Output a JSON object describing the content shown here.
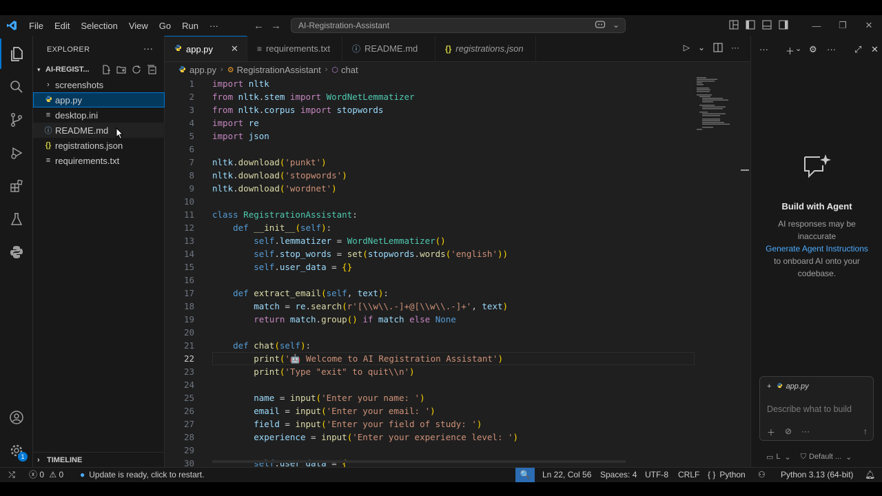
{
  "menu": [
    "File",
    "Edit",
    "Selection",
    "View",
    "Go",
    "Run",
    "···"
  ],
  "command_center": "AI-Registration-Assistant",
  "explorer": {
    "title": "EXPLORER",
    "folder": "AI-REGIST...",
    "items": [
      {
        "label": "screenshots",
        "type": "folder"
      },
      {
        "label": "app.py",
        "type": "python"
      },
      {
        "label": "desktop.ini",
        "type": "text"
      },
      {
        "label": "README.md",
        "type": "info"
      },
      {
        "label": "registrations.json",
        "type": "json"
      },
      {
        "label": "requirements.txt",
        "type": "text"
      }
    ],
    "timeline": "TIMELINE"
  },
  "activity_badge": "1",
  "tabs": [
    {
      "label": "app.py",
      "icon": "python-icon"
    },
    {
      "label": "requirements.txt",
      "icon": "text-icon"
    },
    {
      "label": "README.md",
      "icon": "info-icon"
    },
    {
      "label": "registrations.json",
      "icon": "json-icon"
    }
  ],
  "breadcrumb": [
    "app.py",
    "RegistrationAssistant",
    "chat"
  ],
  "code_lines": [
    {
      "n": "1",
      "t": "import nltk"
    },
    {
      "n": "2",
      "t": "from nltk.stem import WordNetLemmatizer"
    },
    {
      "n": "3",
      "t": "from nltk.corpus import stopwords"
    },
    {
      "n": "4",
      "t": "import re"
    },
    {
      "n": "5",
      "t": "import json"
    },
    {
      "n": "6",
      "t": ""
    },
    {
      "n": "7",
      "t": "nltk.download('punkt')"
    },
    {
      "n": "8",
      "t": "nltk.download('stopwords')"
    },
    {
      "n": "9",
      "t": "nltk.download('wordnet')"
    },
    {
      "n": "10",
      "t": ""
    },
    {
      "n": "11",
      "t": "class RegistrationAssistant:"
    },
    {
      "n": "12",
      "t": "    def __init__(self):"
    },
    {
      "n": "13",
      "t": "        self.lemmatizer = WordNetLemmatizer()"
    },
    {
      "n": "14",
      "t": "        self.stop_words = set(stopwords.words('english'))"
    },
    {
      "n": "15",
      "t": "        self.user_data = {}"
    },
    {
      "n": "16",
      "t": ""
    },
    {
      "n": "17",
      "t": "    def extract_email(self, text):"
    },
    {
      "n": "18",
      "t": "        match = re.search(r'[\\\\w\\\\.-]+@[\\\\w\\\\.-]+', text)"
    },
    {
      "n": "19",
      "t": "        return match.group() if match else None"
    },
    {
      "n": "20",
      "t": ""
    },
    {
      "n": "21",
      "t": "    def chat(self):"
    },
    {
      "n": "22",
      "t": "        print('🤖 Welcome to AI Registration Assistant')"
    },
    {
      "n": "23",
      "t": "        print('Type \"exit\" to quit\\\\n')"
    },
    {
      "n": "24",
      "t": ""
    },
    {
      "n": "25",
      "t": "        name = input('Enter your name: ')"
    },
    {
      "n": "26",
      "t": "        email = input('Enter your email: ')"
    },
    {
      "n": "27",
      "t": "        field = input('Enter your field of study: ')"
    },
    {
      "n": "28",
      "t": "        experience = input('Enter your experience level: ')"
    },
    {
      "n": "29",
      "t": ""
    },
    {
      "n": "30",
      "t": "        self.user_data = {"
    }
  ],
  "current_line": "22",
  "chat": {
    "title": "Build with Agent",
    "sub1": "AI responses may be inaccurate",
    "link": "Generate Agent Instructions",
    "sub2": "to onboard AI onto your codebase.",
    "context_file": "app.py",
    "placeholder": "Describe what to build",
    "mode": "L",
    "model": "Default ..."
  },
  "status": {
    "errors": "0",
    "warnings": "0",
    "update": "Update is ready, click to restart.",
    "position": "Ln 22, Col 56",
    "spaces": "Spaces: 4",
    "encoding": "UTF-8",
    "eol": "CRLF",
    "language": "Python",
    "interpreter": "Python 3.13 (64-bit)"
  }
}
